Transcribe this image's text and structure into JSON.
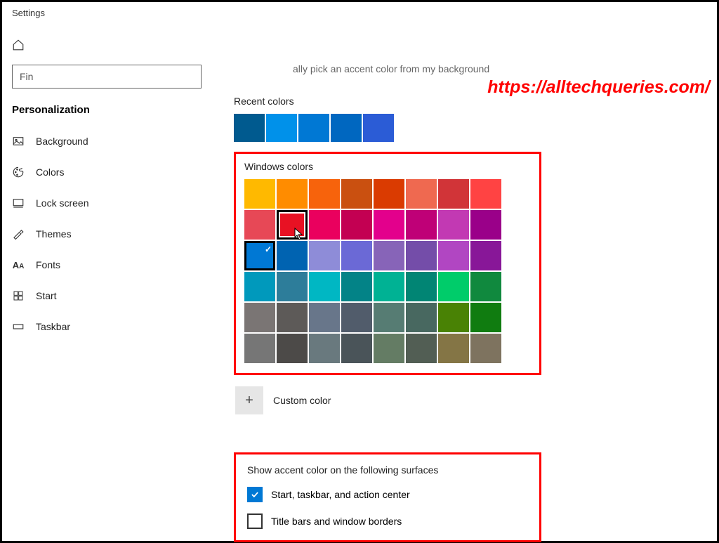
{
  "window": {
    "title": "Settings"
  },
  "sidebar": {
    "search_placeholder": "Fin",
    "section_title": "Personalization",
    "items": [
      {
        "label": "Background"
      },
      {
        "label": "Colors"
      },
      {
        "label": "Lock screen"
      },
      {
        "label": "Themes"
      },
      {
        "label": "Fonts"
      },
      {
        "label": "Start"
      },
      {
        "label": "Taskbar"
      }
    ]
  },
  "main": {
    "truncated_line": "ally pick an accent color from my background",
    "watermark_url": "https://alltechqueries.com/",
    "recent_label": "Recent colors",
    "recent_colors": [
      "#005a8f",
      "#0091ea",
      "#0078d4",
      "#0067c0",
      "#2b5cd6"
    ],
    "windows_label": "Windows colors",
    "windows_colors": [
      [
        "#ffb900",
        "#ff8c00",
        "#f7630c",
        "#ca5010",
        "#da3b01",
        "#ef6950",
        "#d13438",
        "#ff4343"
      ],
      [
        "#e74856",
        "#e81123",
        "#ea005e",
        "#c30052",
        "#e3008c",
        "#bf0077",
        "#c239b3",
        "#9a0089"
      ],
      [
        "#0078d4",
        "#0063b1",
        "#8e8cd8",
        "#6b69d6",
        "#8764b8",
        "#744da9",
        "#b146c2",
        "#881798"
      ],
      [
        "#0099bc",
        "#2d7d9a",
        "#00b7c3",
        "#038387",
        "#00b294",
        "#018574",
        "#00cc6a",
        "#10893e"
      ],
      [
        "#7a7574",
        "#5d5a58",
        "#68768a",
        "#515c6b",
        "#567c73",
        "#486860",
        "#498205",
        "#107c10"
      ],
      [
        "#767676",
        "#4c4a48",
        "#69797e",
        "#4a5459",
        "#647c64",
        "#525e54",
        "#847545",
        "#7e735f"
      ]
    ],
    "selected_index": {
      "row": 2,
      "col": 0
    },
    "hover_index": {
      "row": 1,
      "col": 1
    },
    "custom_color_label": "Custom color",
    "accent_section_label": "Show accent color on the following surfaces",
    "accent_option_1": "Start, taskbar, and action center",
    "accent_option_2": "Title bars and window borders",
    "accent_option_1_checked": true,
    "accent_option_2_checked": false
  }
}
